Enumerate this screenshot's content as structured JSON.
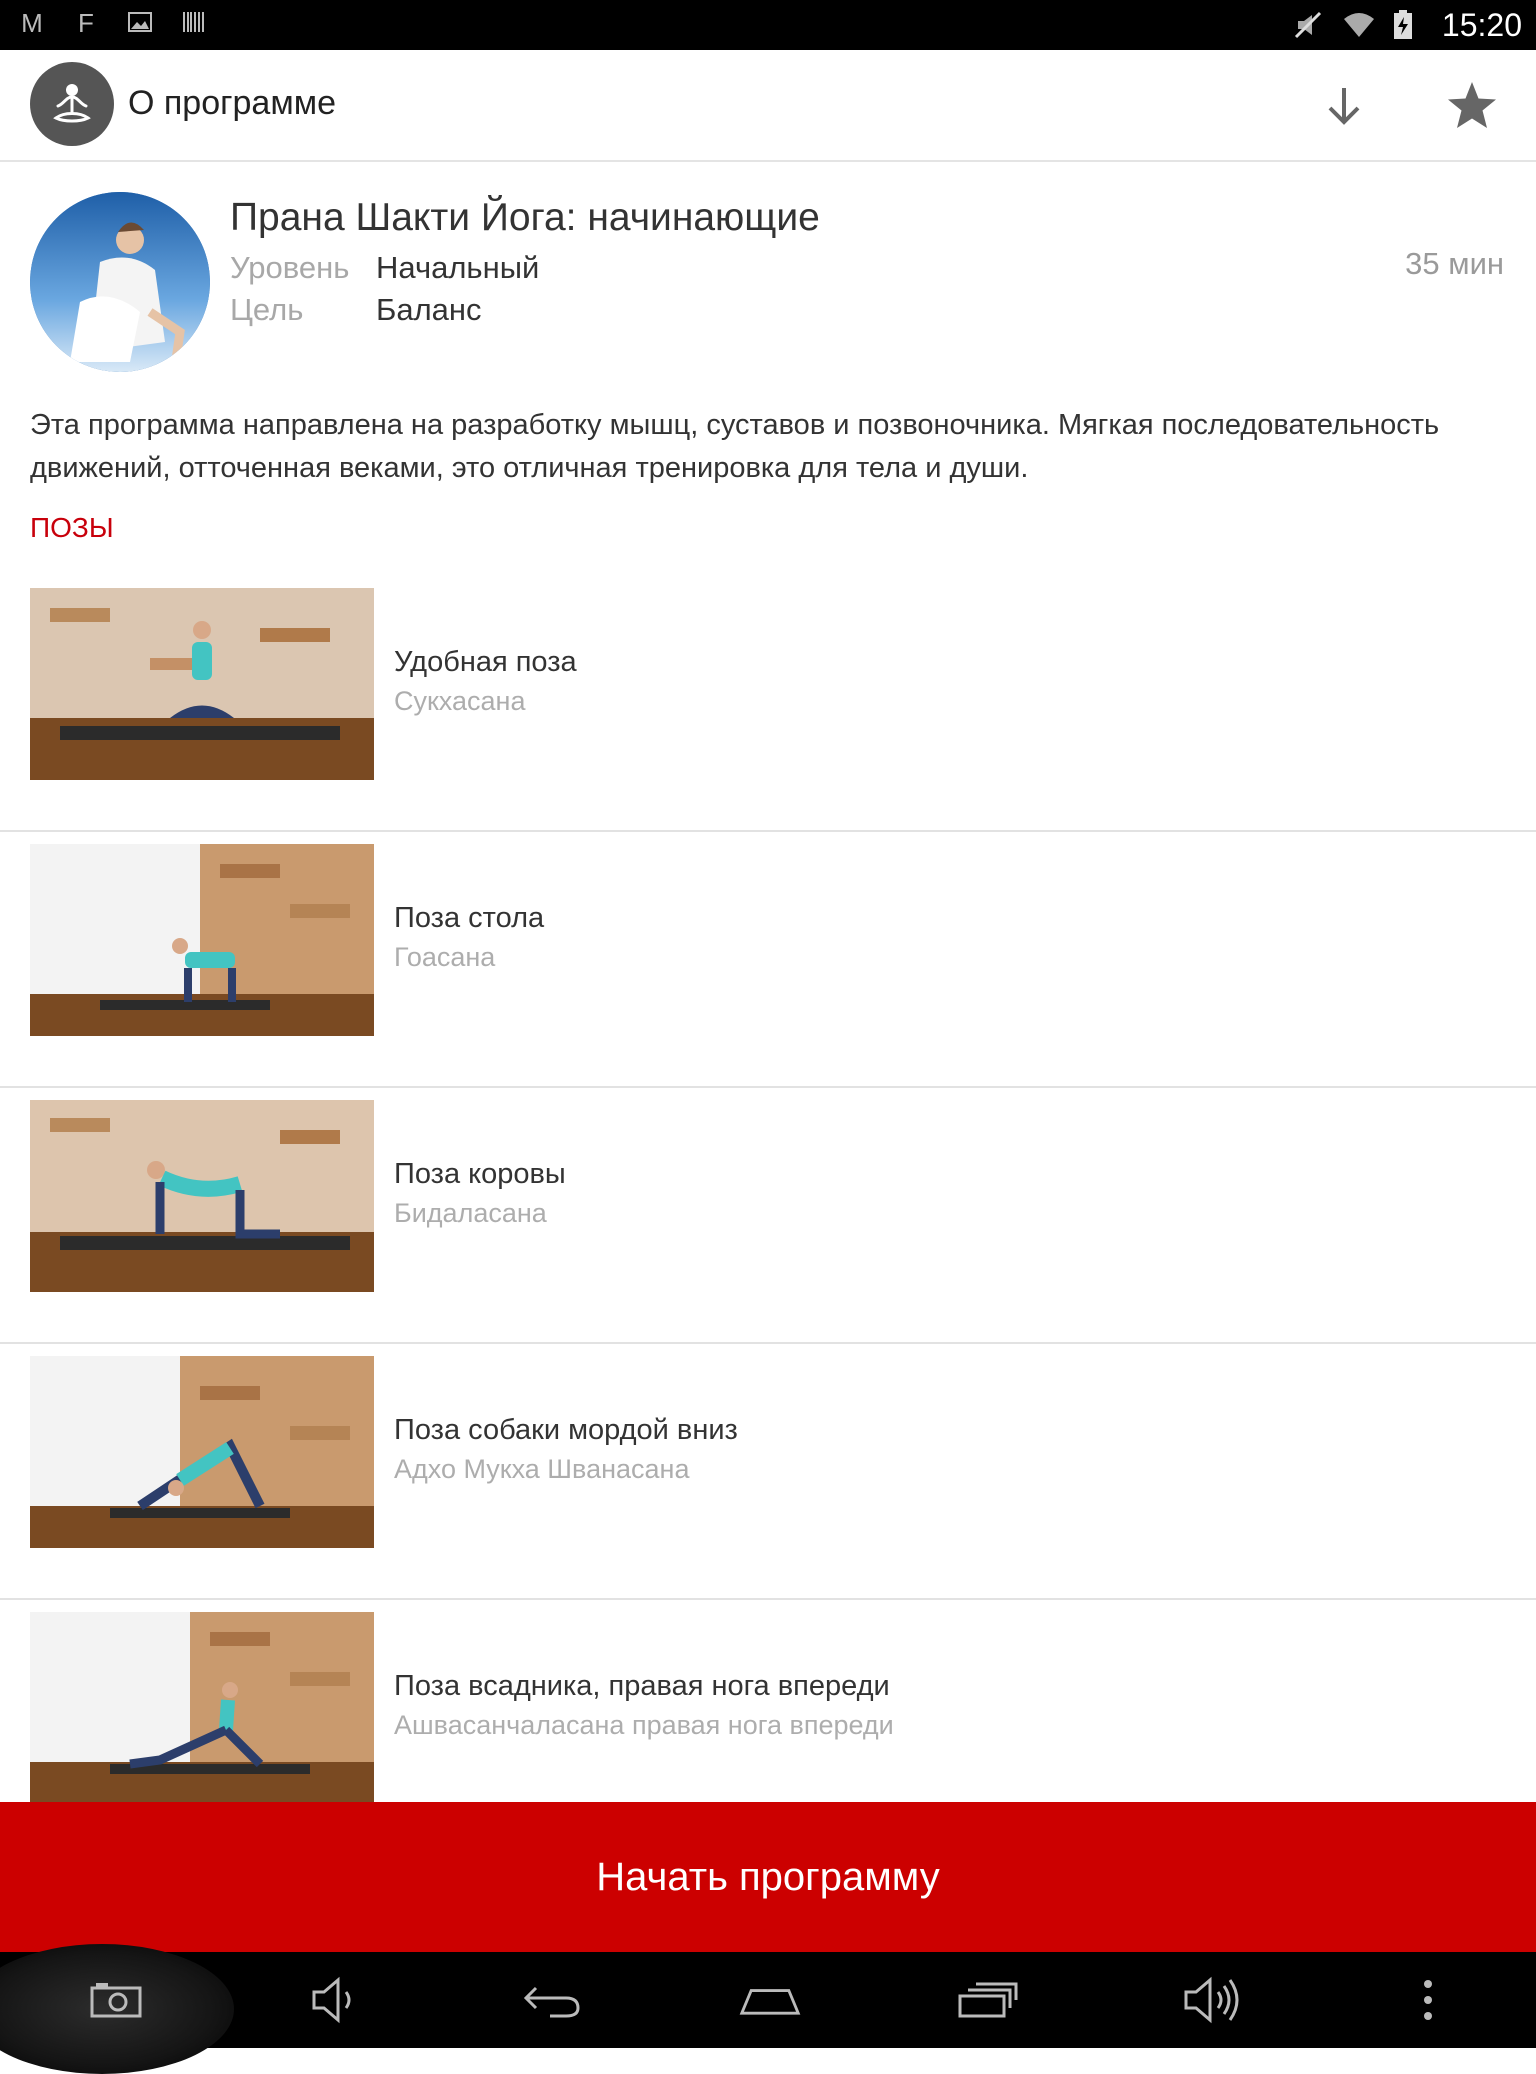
{
  "status_bar": {
    "time": "15:20",
    "left_icons": [
      "m-icon",
      "f-icon",
      "image-icon",
      "barcode-icon"
    ],
    "right_icons": [
      "mute-icon",
      "wifi-icon",
      "battery-charging-icon"
    ]
  },
  "app_bar": {
    "title": "О программе",
    "actions": [
      "download-icon",
      "star-icon"
    ]
  },
  "program": {
    "title": "Прана Шакти Йога: начинающие",
    "duration": "35 мин",
    "level_label": "Уровень",
    "level_value": "Начальный",
    "goal_label": "Цель",
    "goal_value": "Баланс",
    "description": "Эта программа направлена на разработку мышц, суставов и позвоночника. Мягкая последовательность движений, отточенная веками, это отличная тренировка для тела и души."
  },
  "section_label": "ПОЗЫ",
  "poses": [
    {
      "name": "Удобная поза",
      "sanskrit": "Сукхасана"
    },
    {
      "name": "Поза стола",
      "sanskrit": "Гоасана"
    },
    {
      "name": "Поза коровы",
      "sanskrit": "Бидаласана"
    },
    {
      "name": "Поза собаки мордой вниз",
      "sanskrit": "Адхо Мукха Шванасана"
    },
    {
      "name": "Поза всадника, правая нога впереди",
      "sanskrit": "Ашвасанчаласана правая нога впереди"
    }
  ],
  "start_button": "Начать программу",
  "nav_bar": [
    "camera-icon",
    "volume-down-icon",
    "back-icon",
    "home-icon",
    "recent-apps-icon",
    "volume-up-icon",
    "more-icon"
  ],
  "colors": {
    "accent": "#cc0000",
    "status_bar_bg": "#000000",
    "text_primary": "#333333",
    "text_secondary": "#a8a8a8"
  }
}
